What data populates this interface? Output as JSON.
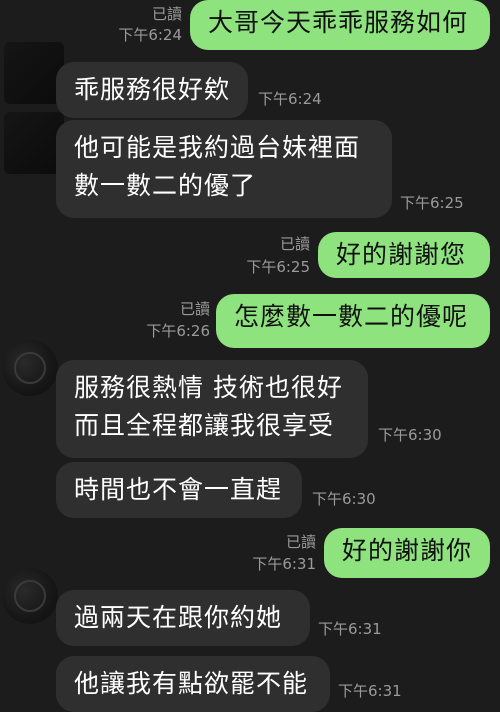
{
  "messages": [
    {
      "side": "out",
      "text": "大哥今天乖乖服務如何",
      "read": "已讀",
      "time": "下午6:24"
    },
    {
      "side": "in",
      "text": "乖服務很好欸",
      "time": "下午6:24"
    },
    {
      "side": "in",
      "lines": [
        "他可能是我約過台妹裡面",
        "數一數二的優了"
      ],
      "time": "下午6:25"
    },
    {
      "side": "out",
      "text": "好的謝謝您",
      "read": "已讀",
      "time": "下午6:25"
    },
    {
      "side": "out",
      "text": "怎麼數一數二的優呢",
      "read": "已讀",
      "time": "下午6:26"
    },
    {
      "side": "in",
      "lines": [
        "服務很熱情  技術也很好",
        "而且全程都讓我很享受"
      ],
      "time": "下午6:30"
    },
    {
      "side": "in",
      "text": "時間也不會一直趕",
      "time": "下午6:30"
    },
    {
      "side": "out",
      "text": "好的謝謝你",
      "read": "已讀",
      "time": "下午6:31"
    },
    {
      "side": "in",
      "text": "過兩天在跟你約她",
      "time": "下午6:31"
    },
    {
      "side": "in",
      "text": "他讓我有點欲罷不能",
      "time": "下午6:31"
    }
  ]
}
